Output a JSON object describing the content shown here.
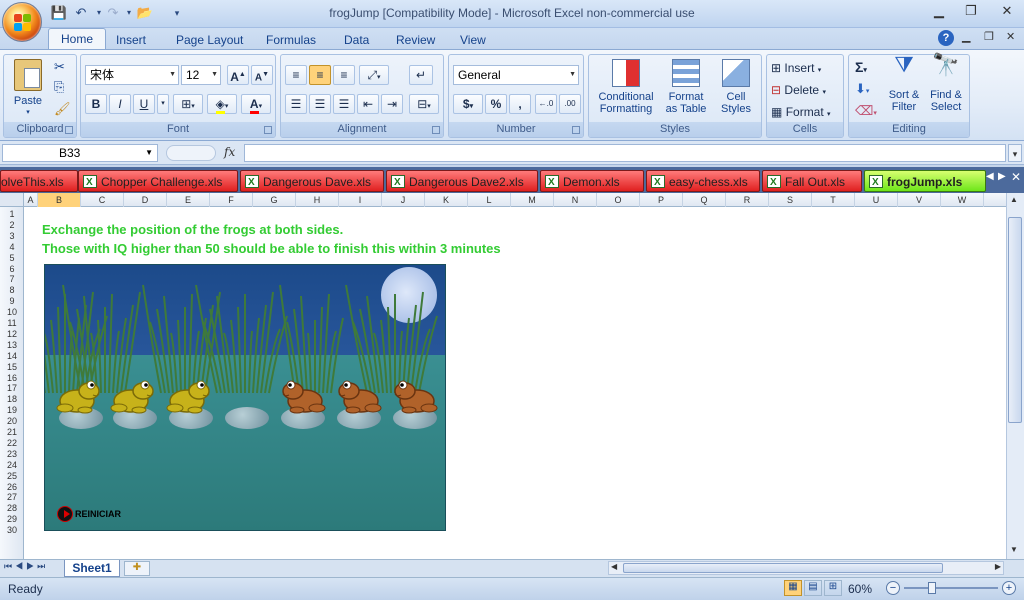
{
  "window": {
    "title": "frogJump  [Compatibility Mode] - Microsoft Excel non-commercial use",
    "controls": [
      "minimize",
      "restore",
      "close"
    ]
  },
  "ribbon": {
    "tabs": [
      "Home",
      "Insert",
      "Page Layout",
      "Formulas",
      "Data",
      "Review",
      "View"
    ],
    "active_tab": "Home",
    "clipboard": {
      "label": "Clipboard",
      "paste": "Paste"
    },
    "font": {
      "label": "Font",
      "name": "宋体",
      "size": "12",
      "bold": "B",
      "italic": "I",
      "underline": "U"
    },
    "alignment": {
      "label": "Alignment"
    },
    "number": {
      "label": "Number",
      "format": "General",
      "currency": "$",
      "percent": "%",
      "comma": ","
    },
    "styles": {
      "label": "Styles",
      "conditional": [
        "Conditional",
        "Formatting"
      ],
      "format_table": [
        "Format",
        "as Table"
      ],
      "cell_styles": [
        "Cell",
        "Styles"
      ]
    },
    "cells": {
      "label": "Cells",
      "insert": "Insert",
      "delete": "Delete",
      "format": "Format"
    },
    "editing": {
      "label": "Editing",
      "sigma": "Σ",
      "sort": [
        "Sort &",
        "Filter"
      ],
      "find": [
        "Find &",
        "Select"
      ]
    }
  },
  "formula_bar": {
    "name_box": "B33",
    "fx": "fx",
    "value": ""
  },
  "workbook_tabs": [
    {
      "name": "olveThis.xls",
      "active": false
    },
    {
      "name": "Chopper Challenge.xls",
      "active": false
    },
    {
      "name": "Dangerous Dave.xls",
      "active": false
    },
    {
      "name": "Dangerous Dave2.xls",
      "active": false
    },
    {
      "name": "Demon.xls",
      "active": false
    },
    {
      "name": "easy-chess.xls",
      "active": false
    },
    {
      "name": "Fall Out.xls",
      "active": false
    },
    {
      "name": "frogJump.xls",
      "active": true
    }
  ],
  "sheet": {
    "columns": [
      "A",
      "B",
      "C",
      "D",
      "E",
      "F",
      "G",
      "H",
      "I",
      "J",
      "K",
      "L",
      "M",
      "N",
      "O",
      "P",
      "Q",
      "R",
      "S",
      "T",
      "U",
      "V",
      "W"
    ],
    "rows": [
      "1",
      "2",
      "3",
      "4",
      "5",
      "6",
      "7",
      "8",
      "9",
      "10",
      "11",
      "12",
      "13",
      "14",
      "15",
      "16",
      "17",
      "18",
      "19",
      "20",
      "21",
      "22",
      "23",
      "24",
      "25",
      "26",
      "27",
      "28",
      "29",
      "30"
    ],
    "selected_column": "B",
    "line1": "Exchange the position of the frogs at both sides.",
    "line2": "Those with IQ higher than 50 should be able to finish this within 3 minutes",
    "text_color": "#33cc33"
  },
  "game": {
    "restart_label": "REINICIAR",
    "frogs": [
      {
        "color": "green",
        "facing": "right"
      },
      {
        "color": "green",
        "facing": "right"
      },
      {
        "color": "green",
        "facing": "right"
      },
      {
        "color": "none",
        "facing": "none"
      },
      {
        "color": "brown",
        "facing": "left"
      },
      {
        "color": "brown",
        "facing": "left"
      },
      {
        "color": "brown",
        "facing": "left"
      }
    ]
  },
  "sheet_tabs": {
    "active": "Sheet1"
  },
  "status_bar": {
    "status": "Ready",
    "zoom": "60%"
  }
}
